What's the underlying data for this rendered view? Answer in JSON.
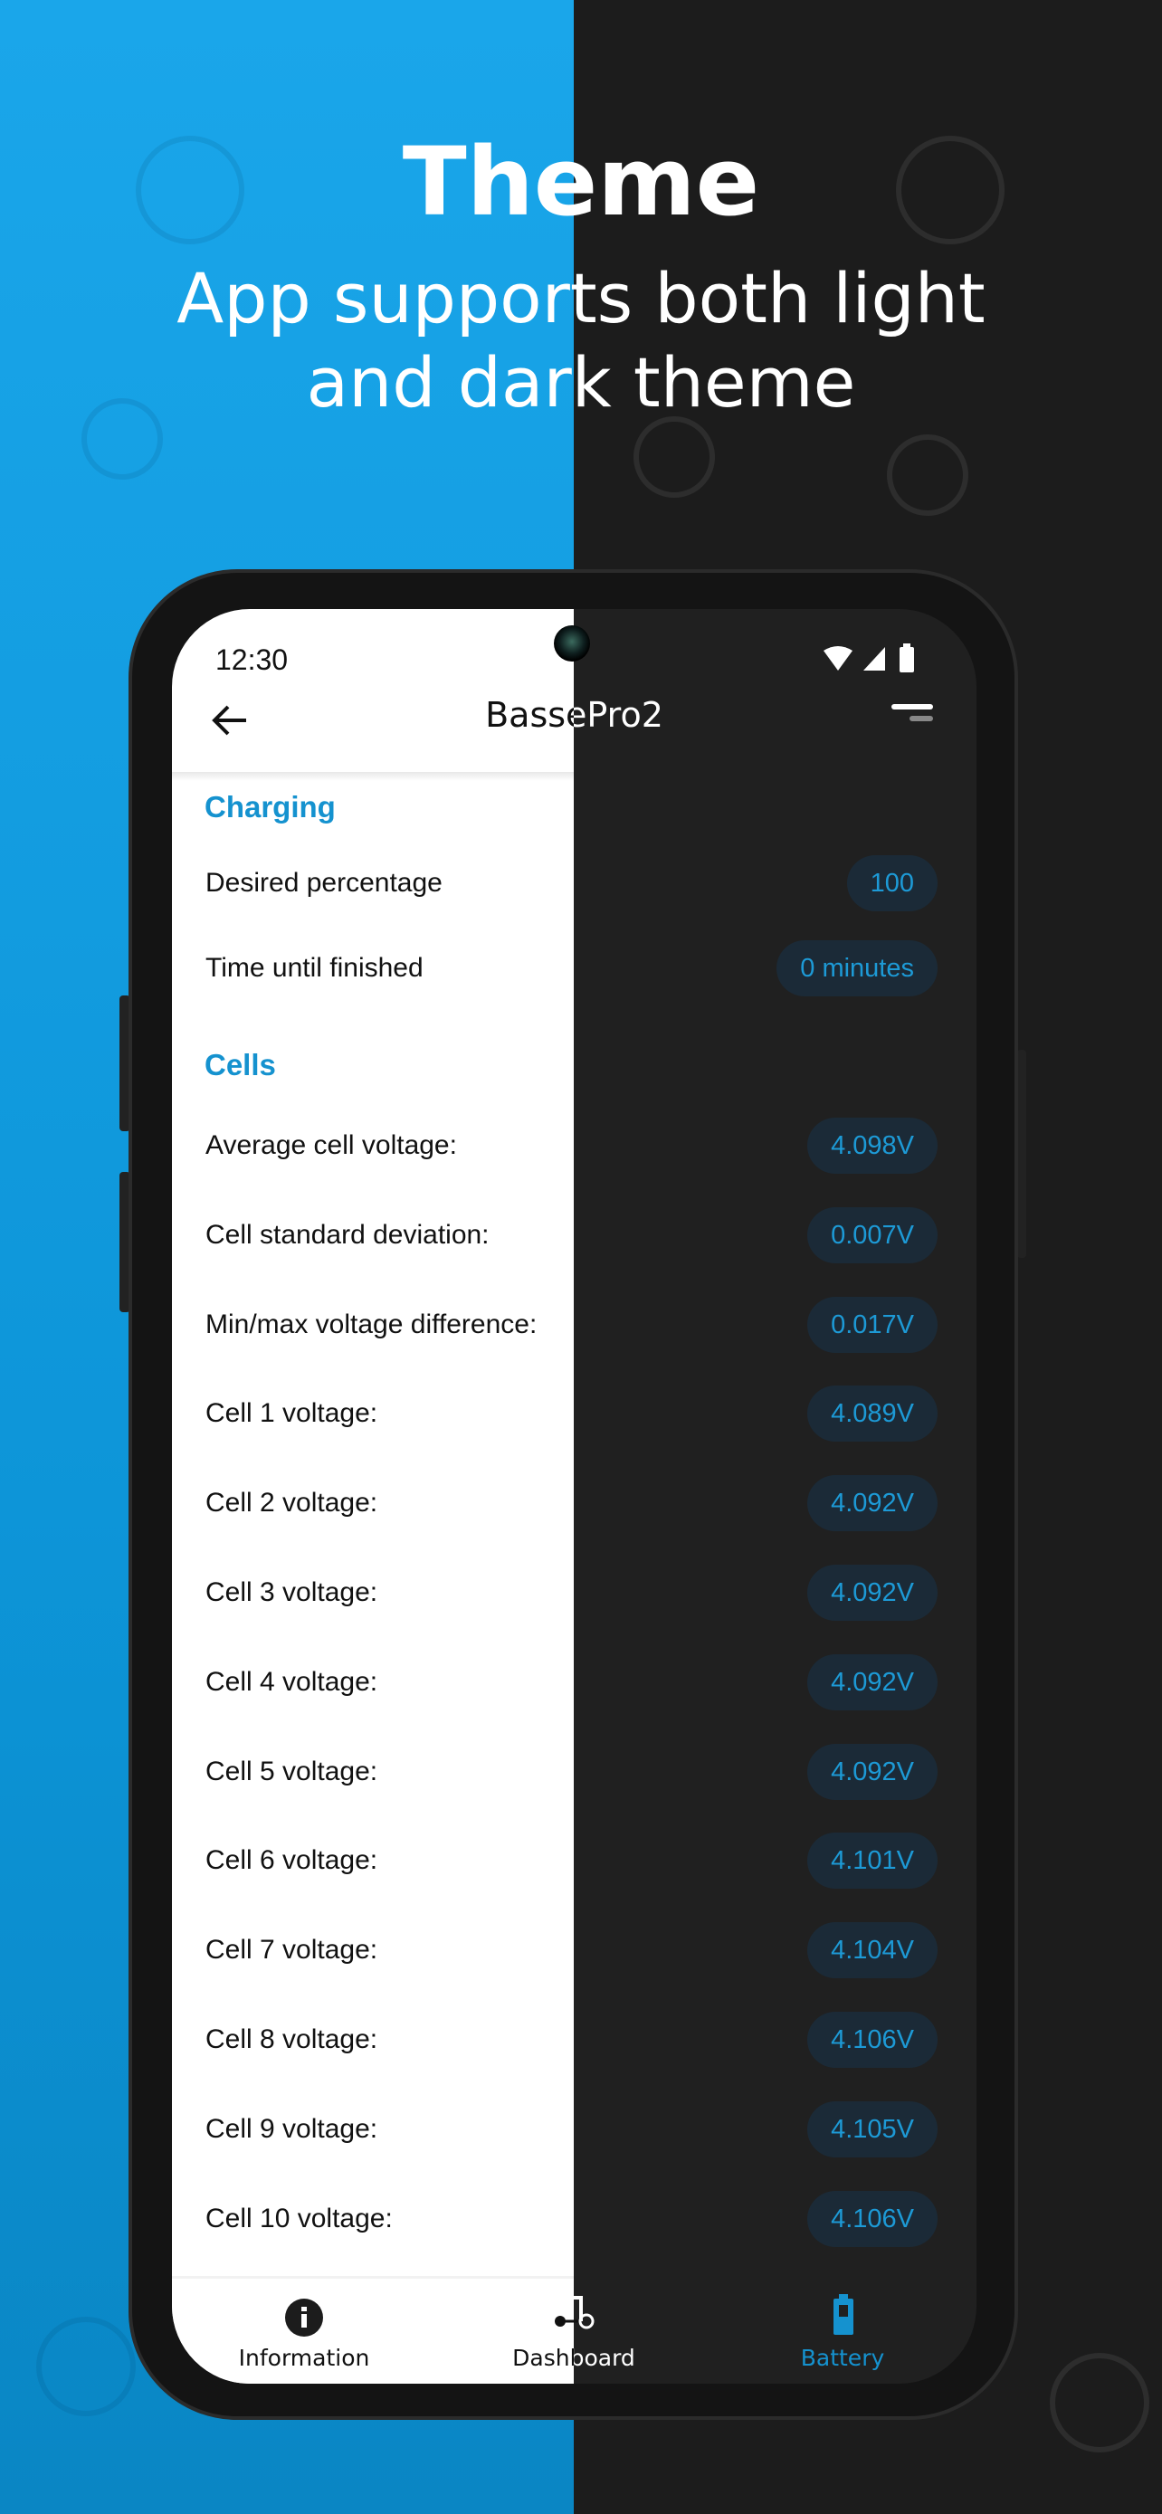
{
  "hero": {
    "title": "Theme",
    "subtitle_line1": "App supports both light",
    "subtitle_line2": "and dark theme"
  },
  "status_bar": {
    "time": "12:30",
    "icons": [
      "wifi-icon",
      "signal-icon",
      "battery-icon"
    ]
  },
  "app_bar": {
    "title": "BassePro2",
    "back_icon": "arrow-left-icon",
    "menu_icon": "sort-menu-icon"
  },
  "sections": {
    "charging": {
      "title": "Charging",
      "rows": [
        {
          "label": "Desired percentage",
          "value": "100"
        },
        {
          "label": "Time until finished",
          "value": "0 minutes"
        }
      ]
    },
    "cells": {
      "title": "Cells",
      "rows": [
        {
          "label": "Average cell voltage:",
          "value": "4.098V"
        },
        {
          "label": "Cell standard deviation:",
          "value": "0.007V"
        },
        {
          "label": "Min/max voltage difference:",
          "value": "0.017V"
        },
        {
          "label": "Cell 1 voltage:",
          "value": "4.089V"
        },
        {
          "label": "Cell 2 voltage:",
          "value": "4.092V"
        },
        {
          "label": "Cell 3 voltage:",
          "value": "4.092V"
        },
        {
          "label": "Cell 4 voltage:",
          "value": "4.092V"
        },
        {
          "label": "Cell 5 voltage:",
          "value": "4.092V"
        },
        {
          "label": "Cell 6 voltage:",
          "value": "4.101V"
        },
        {
          "label": "Cell 7 voltage:",
          "value": "4.104V"
        },
        {
          "label": "Cell 8 voltage:",
          "value": "4.106V"
        },
        {
          "label": "Cell 9 voltage:",
          "value": "4.105V"
        },
        {
          "label": "Cell 10 voltage:",
          "value": "4.106V"
        }
      ]
    }
  },
  "bottom_nav": {
    "items": [
      {
        "label": "Information",
        "icon": "info-icon"
      },
      {
        "label": "Dashboard",
        "icon": "scooter-icon"
      },
      {
        "label": "Battery",
        "icon": "battery-icon",
        "active": true
      }
    ]
  },
  "colors": {
    "accent": "#1592cf",
    "light_bg": "#ffffff",
    "dark_bg": "#202020",
    "pill_bg": "#1b2a37",
    "hero_blue": "#1aa6ea"
  }
}
